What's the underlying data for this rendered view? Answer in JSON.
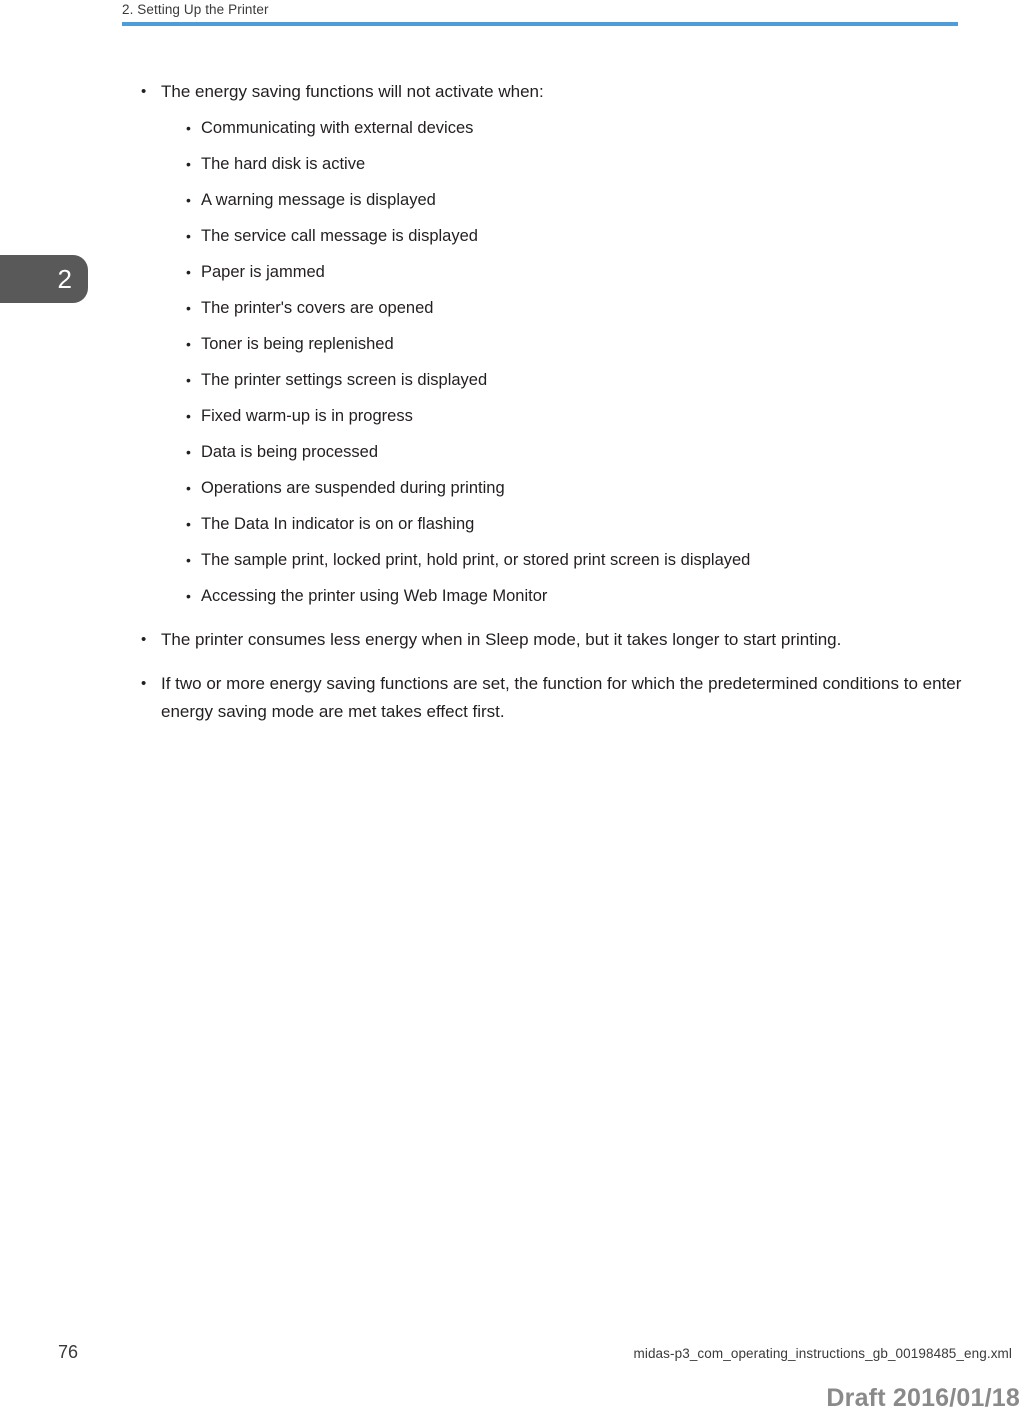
{
  "header": {
    "title": "2. Setting Up the Printer",
    "rule_color": "#4e9dd9"
  },
  "chapter_tab": {
    "number": "2",
    "background_color": "#595959",
    "text_color": "#ffffff"
  },
  "content": {
    "bullet_marker": "•",
    "items": [
      {
        "text": "The energy saving functions will not activate when:",
        "subitems": [
          "Communicating with external devices",
          "The hard disk is active",
          "A warning message is displayed",
          "The service call message is displayed",
          "Paper is jammed",
          "The printer's covers are opened",
          "Toner is being replenished",
          "The printer settings screen is displayed",
          "Fixed warm-up is in progress",
          "Data is being processed",
          "Operations are suspended during printing",
          "The Data In indicator is on or flashing",
          "The sample print, locked print, hold print, or stored print screen is displayed",
          "Accessing the printer using Web Image Monitor"
        ]
      },
      {
        "text": "The printer consumes less energy when in Sleep mode, but it takes longer to start printing.",
        "subitems": []
      },
      {
        "text": "If two or more energy saving functions are set, the function for which the predetermined conditions to enter energy saving mode are met takes effect first.",
        "subitems": []
      }
    ]
  },
  "footer": {
    "page_number": "76",
    "filename": "midas-p3_com_operating_instructions_gb_00198485_eng.xml",
    "draft_label": "Draft 2016/01/18",
    "draft_color": "#8a8a8a"
  }
}
